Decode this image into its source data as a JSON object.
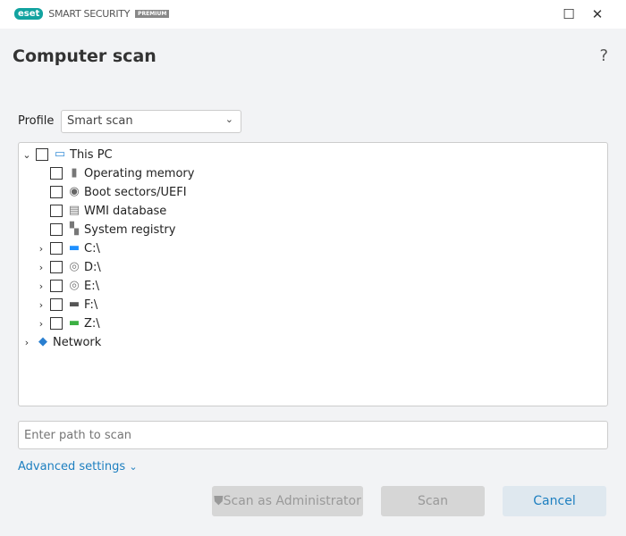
{
  "titlebar": {
    "brand": "eset",
    "product": "SMART SECURITY",
    "edition": "PREMIUM",
    "maximize": "☐",
    "close": "✕"
  },
  "page": {
    "title": "Computer scan",
    "help": "?"
  },
  "profile": {
    "label": "Profile",
    "value": "Smart scan"
  },
  "tree": {
    "root": "This PC",
    "items": [
      "Operating memory",
      "Boot sectors/UEFI",
      "WMI database",
      "System registry"
    ],
    "drives": [
      "C:\\",
      "D:\\",
      "E:\\",
      "F:\\",
      "Z:\\"
    ],
    "network": "Network"
  },
  "path_input": {
    "placeholder": "Enter path to scan"
  },
  "advanced": "Advanced settings",
  "buttons": {
    "admin": "Scan as Administrator",
    "scan": "Scan",
    "cancel": "Cancel"
  }
}
